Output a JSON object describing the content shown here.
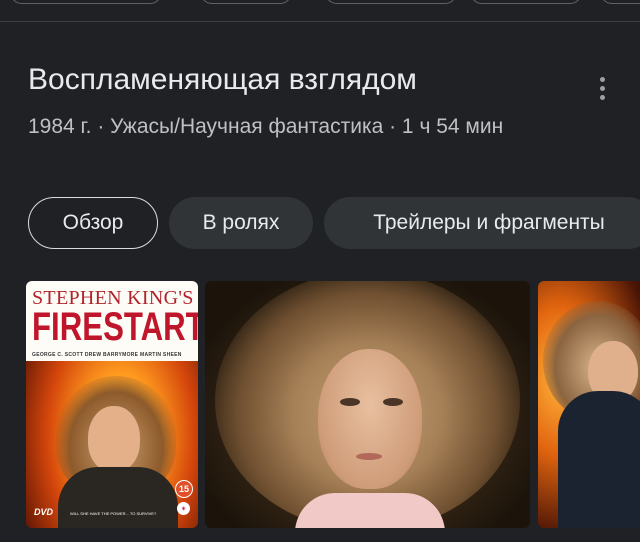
{
  "movie": {
    "title": "Воспламеняющая взглядом",
    "meta": "1984 г. · Ужасы/Научная фантастика · 1 ч 54 мин"
  },
  "tabs": [
    {
      "label": "Обзор",
      "active": true
    },
    {
      "label": "В ролях",
      "active": false
    },
    {
      "label": "Трейлеры и фрагменты",
      "active": false
    }
  ],
  "poster": {
    "brand_line1": "STEPHEN KING'S",
    "brand_line2": "FIRESTARTER",
    "cast": "GEORGE C. SCOTT   DREW BARRYMORE   MARTIN SHEEN",
    "age_badge": "15",
    "dvd": "DVD",
    "tagline": "WILL SHE HAVE THE POWER... TO SURVIVE?"
  },
  "colors": {
    "background": "#202124",
    "chip_bg": "#303436",
    "text_primary": "#e8eaed",
    "text_secondary": "#bdc1c6"
  },
  "icons": {
    "more": "more-vert-icon"
  }
}
